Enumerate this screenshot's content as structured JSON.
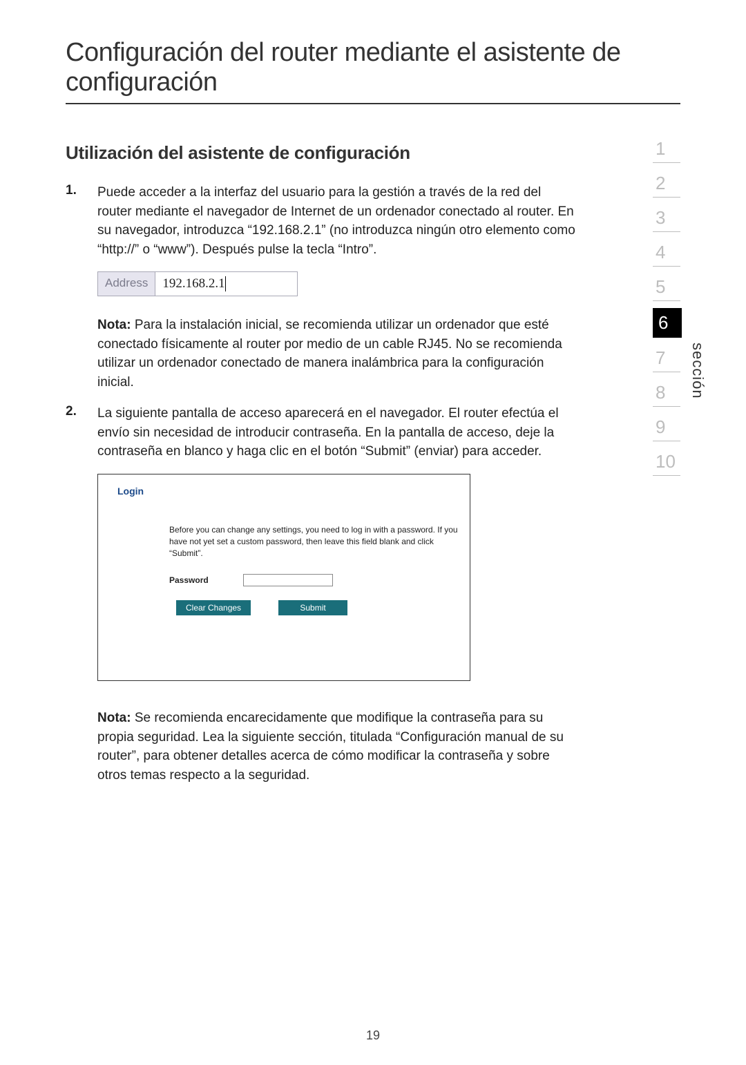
{
  "title": "Configuración del router mediante el asistente de configuración",
  "subtitle": "Utilización del asistente de configuración",
  "step1": {
    "num": "1.",
    "text": "Puede acceder a la interfaz del usuario para la gestión a través de la red del router mediante el navegador de Internet de un ordenador conectado al router. En su navegador, introduzca “192.168.2.1” (no introduzca ningún otro elemento como “http://” o “www”). Después pulse la tecla “Intro”."
  },
  "addr": {
    "label": "Address",
    "value": "192.168.2.1"
  },
  "note1_bold": "Nota:",
  "note1_text": " Para la instalación inicial, se recomienda utilizar un ordenador que esté conectado físicamente al router por medio de un cable RJ45. No se recomienda utilizar un ordenador conectado de manera inalámbrica para la configuración inicial.",
  "step2": {
    "num": "2.",
    "text": "La siguiente pantalla de acceso aparecerá en el navegador. El router efectúa el envío sin necesidad de introducir contraseña. En la pantalla de acceso, deje la contraseña en blanco y haga clic en el botón “Submit” (enviar) para acceder."
  },
  "login": {
    "heading": "Login",
    "desc": "Before you can change any settings, you need to log in with a password. If you have not yet set a custom password, then leave this field blank and click “Submit”.",
    "pw_label": "Password",
    "btn_clear": "Clear Changes",
    "btn_submit": "Submit"
  },
  "note2_bold": "Nota:",
  "note2_text": " Se recomienda encarecidamente que modifique la contraseña para su propia seguridad. Lea la siguiente sección, titulada “Configuración manual de su router”, para obtener detalles acerca de cómo modificar la contraseña y sobre otros temas respecto a la seguridad.",
  "nav": {
    "items": [
      "1",
      "2",
      "3",
      "4",
      "5",
      "6",
      "7",
      "8",
      "9",
      "10"
    ],
    "active_index": 5,
    "label": "sección"
  },
  "page_num": "19"
}
